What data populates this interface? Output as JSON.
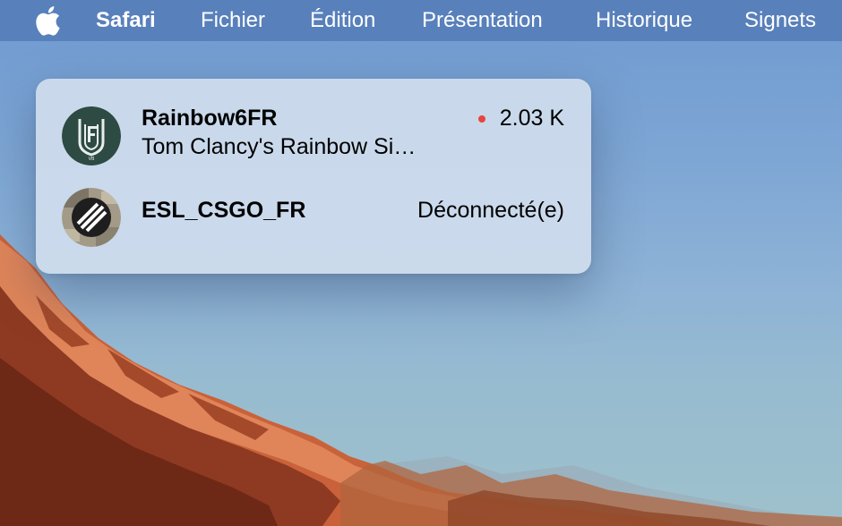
{
  "menubar": {
    "app_name": "Safari",
    "items": [
      "Fichier",
      "Édition",
      "Présentation",
      "Historique",
      "Signets"
    ],
    "icon": "apple-icon"
  },
  "channels": [
    {
      "name": "Rainbow6FR",
      "subtitle": "Tom Clancy's Rainbow Si…",
      "status": "2.03 K",
      "live": true,
      "avatar_icon": "rainbow-six-logo-icon"
    },
    {
      "name": "ESL_CSGO_FR",
      "subtitle": "",
      "status": "Déconnecté(e)",
      "live": false,
      "avatar_icon": "esl-logo-icon"
    }
  ],
  "colors": {
    "live_dot": "#e8453c",
    "menubar": "#567eb9",
    "panel": "#cedcec"
  }
}
